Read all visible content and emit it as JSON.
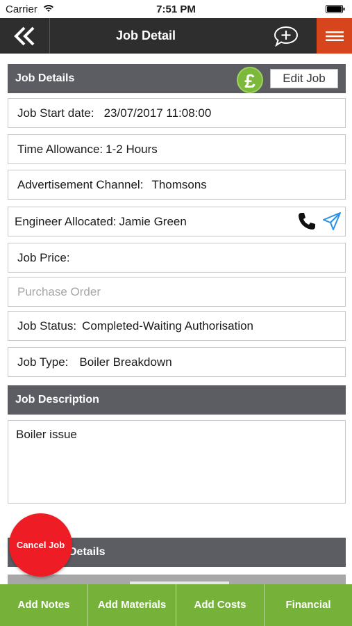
{
  "status_bar": {
    "carrier": "Carrier",
    "time": "7:51 PM"
  },
  "nav": {
    "title": "Job Detail"
  },
  "job_details": {
    "header": "Job Details",
    "edit_label": "Edit Job",
    "pound_symbol": "£",
    "fields": [
      {
        "label": "Job Start date:",
        "value": "23/07/2017 11:08:00"
      },
      {
        "label": "Time Allowance:",
        "value": "1-2 Hours"
      },
      {
        "label": "Advertisement Channel:",
        "value": "Thomsons"
      },
      {
        "label": "Engineer Allocated:",
        "value": "Jamie Green"
      },
      {
        "label": "Job Price:",
        "value": ""
      },
      {
        "label": "Job Status:",
        "value": "Completed-Waiting Authorisation"
      },
      {
        "label": "Job Type:",
        "value": "Boiler Breakdown"
      }
    ],
    "purchase_order_placeholder": "Purchase Order"
  },
  "job_description": {
    "header": "Job Description",
    "text": "Boiler  issue"
  },
  "next_section": {
    "header": "Details"
  },
  "cancel_label": "Cancel Job",
  "bottom_bar": [
    "Add Notes",
    "Add Materials",
    "Add Costs",
    "Financial"
  ],
  "colors": {
    "nav": "#2e2e2e",
    "menu": "#d6451b",
    "section": "#5b5d63",
    "toolbar": "#76b13a",
    "cancel": "#ee1c24",
    "pound": "#7bb83c"
  }
}
